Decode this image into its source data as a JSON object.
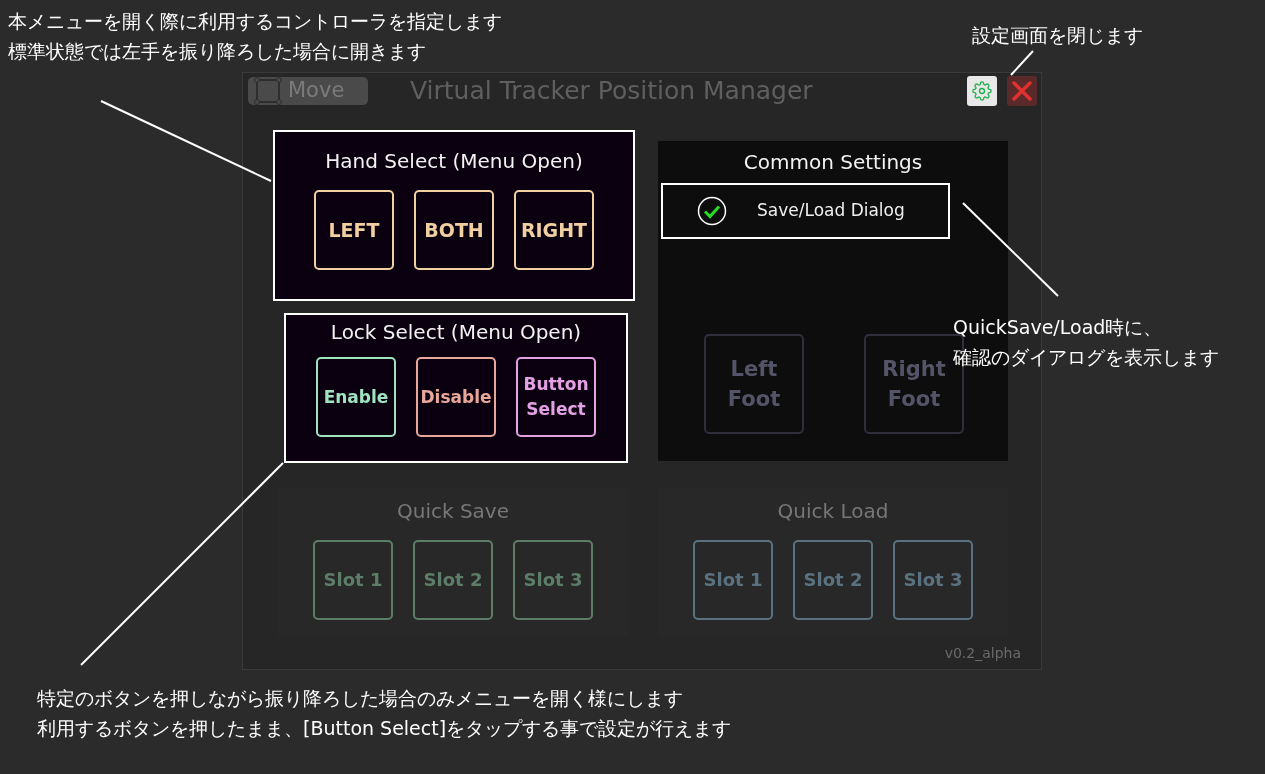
{
  "window": {
    "move_button": "Move",
    "title": "Virtual Tracker Position Manager"
  },
  "hand_select": {
    "title": "Hand Select (Menu Open)",
    "buttons": [
      "LEFT",
      "BOTH",
      "RIGHT"
    ]
  },
  "lock_select": {
    "title": "Lock Select (Menu Open)",
    "buttons": [
      {
        "label": "Enable",
        "color": "#9fe3c0"
      },
      {
        "label": "Disable",
        "color": "#e8a79a"
      },
      {
        "label": "Button Select",
        "color": "#e3a0e3"
      }
    ]
  },
  "common_settings": {
    "title": "Common Settings",
    "option": {
      "label": "Save/Load Dialog",
      "checked": true
    },
    "faded_buttons": [
      "Left Foot",
      "Right Foot"
    ]
  },
  "quick_save": {
    "title": "Quick Save",
    "slots": [
      "Slot 1",
      "Slot 2",
      "Slot 3"
    ]
  },
  "quick_load": {
    "title": "Quick Load",
    "slots": [
      "Slot 1",
      "Slot 2",
      "Slot 3"
    ]
  },
  "version": "v0.2_alpha",
  "annotations": [
    {
      "kind": "top-left",
      "lines": [
        "本メニューを開く際に利用するコントローラを指定します",
        "標準状態では左手を振り降ろした場合に開きます"
      ]
    },
    {
      "kind": "top-right",
      "lines": [
        "設定画面を閉じます"
      ]
    },
    {
      "kind": "right",
      "lines": [
        "QuickSave/Load時に、",
        "確認のダイアログを表示します"
      ]
    },
    {
      "kind": "bottom",
      "lines": [
        "特定のボタンを押しながら振り降ろした場合のみメニューを開く様にします",
        "利用するボタンを押したまま、[Button Select]をタップする事で設定が行えます"
      ]
    }
  ]
}
